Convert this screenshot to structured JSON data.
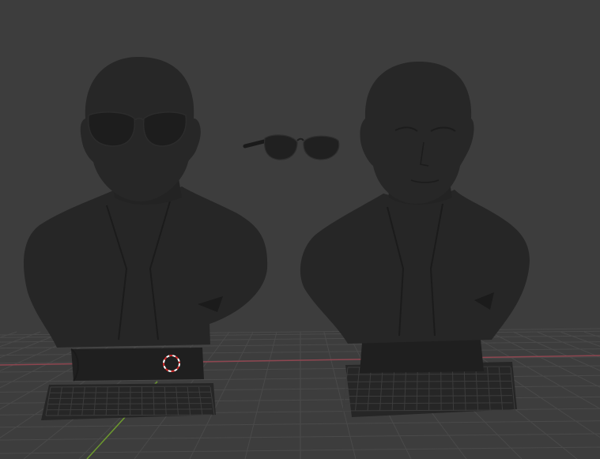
{
  "viewport": {
    "background": "#3d3d3d",
    "grid_color": "#4a4a4a",
    "x_axis_color": "#a24a52",
    "y_axis_color": "#6d9a2e",
    "model_color": "#242424",
    "model_shadow_color": "#1a1a1a",
    "cursor_color_a": "#ffffff",
    "cursor_color_b": "#d32c2c"
  },
  "scene": {
    "objects": [
      {
        "name": "bust-with-sunglasses",
        "icon": "bust-model"
      },
      {
        "name": "sunglasses",
        "icon": "sunglasses-model"
      },
      {
        "name": "bust-without-sunglasses",
        "icon": "bust-model"
      }
    ],
    "cursor_icon": "3d-cursor-icon"
  }
}
